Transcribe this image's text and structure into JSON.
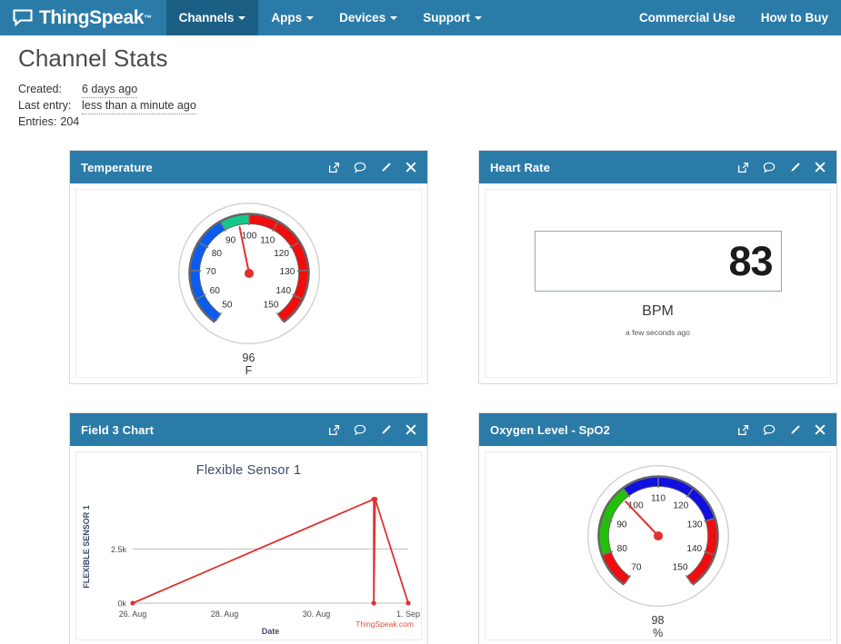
{
  "navbar": {
    "brand": "ThingSpeak",
    "brand_tm": "™",
    "brand_icon": "chat-bubble-icon",
    "items": [
      {
        "label": "Channels",
        "has_caret": true,
        "active": true
      },
      {
        "label": "Apps",
        "has_caret": true,
        "active": false
      },
      {
        "label": "Devices",
        "has_caret": true,
        "active": false
      },
      {
        "label": "Support",
        "has_caret": true,
        "active": false
      }
    ],
    "right_items": [
      {
        "label": "Commercial Use"
      },
      {
        "label": "How to Buy"
      }
    ],
    "bg_color": "#2b7ba8",
    "active_bg_color": "#1c5f84"
  },
  "page": {
    "title": "Channel Stats",
    "stats": {
      "created_label": "Created:",
      "created_value": "6 days ago",
      "last_entry_label": "Last entry:",
      "last_entry_value": "less than a minute ago",
      "entries_label": "Entries:",
      "entries_value": "204"
    }
  },
  "widget_icons": [
    {
      "name": "external-link-icon",
      "title": "Open in new window"
    },
    {
      "name": "comment-icon",
      "title": "Comment"
    },
    {
      "name": "pencil-edit-icon",
      "title": "Edit"
    },
    {
      "name": "close-x-icon",
      "title": "Close"
    }
  ],
  "widgets": [
    {
      "id": "temperature",
      "title": "Temperature",
      "type": "gauge",
      "value": "96",
      "unit": "F"
    },
    {
      "id": "heart-rate",
      "title": "Heart Rate",
      "type": "numeric",
      "value": "83",
      "unit": "BPM",
      "timestamp": "a few seconds ago"
    },
    {
      "id": "field-3-chart",
      "title": "Field 3 Chart",
      "type": "chart",
      "watermark": "ThingSpeak.com"
    },
    {
      "id": "oxygen-level-spo2",
      "title": "Oxygen Level - SpO2",
      "type": "gauge",
      "value": "98",
      "unit": "%"
    }
  ],
  "chart_data": {
    "type": "line",
    "title": "Flexible Sensor 1",
    "xlabel": "Date",
    "ylabel": "FLEXIBLE SENSOR 1",
    "x_ticks": [
      "26. Aug",
      "28. Aug",
      "30. Aug",
      "1. Sep"
    ],
    "y_ticks": [
      "0k",
      "2.5k"
    ],
    "y_tick_values": [
      0,
      2500
    ],
    "ylim": [
      0,
      5200
    ],
    "xlim": [
      "26. Aug",
      "1. Sep"
    ],
    "grid": true,
    "legend": false,
    "line_color": "#e03131",
    "series": [
      {
        "name": "Flexible Sensor 1",
        "points": [
          {
            "x": "26. Aug",
            "x_frac": 0.0,
            "y": 0
          },
          {
            "x": "~31. Aug",
            "x_frac": 0.875,
            "y": 4800
          },
          {
            "x": "~31. Aug",
            "x_frac": 0.875,
            "y": 0
          },
          {
            "x": "~31. Aug",
            "x_frac": 0.88,
            "y": 4800
          },
          {
            "x": "1. Sep",
            "x_frac": 1.0,
            "y": 0
          }
        ]
      }
    ]
  },
  "gauges": {
    "temperature": {
      "min": 50,
      "max": 150,
      "value": 96,
      "tick_labels": [
        50,
        60,
        70,
        80,
        90,
        100,
        110,
        120,
        130,
        140,
        150
      ],
      "start_angle_deg": 215,
      "sweep_deg": 290,
      "bands": [
        {
          "from": 50,
          "to": 90,
          "color": "#0a5bef"
        },
        {
          "from": 90,
          "to": 100,
          "color": "#13c98a"
        },
        {
          "from": 100,
          "to": 150,
          "color": "#f10d0d"
        }
      ],
      "needle_color": "#e03131"
    },
    "oxygen": {
      "min": 70,
      "max": 150,
      "value": 98,
      "tick_labels": [
        70,
        80,
        90,
        100,
        110,
        120,
        130,
        140,
        150
      ],
      "start_angle_deg": 215,
      "sweep_deg": 290,
      "bands": [
        {
          "from": 70,
          "to": 80,
          "color": "#f10d0d"
        },
        {
          "from": 80,
          "to": 100,
          "color": "#22c006"
        },
        {
          "from": 100,
          "to": 130,
          "color": "#1010e0"
        },
        {
          "from": 130,
          "to": 150,
          "color": "#f10d0d"
        }
      ],
      "needle_color": "#e03131"
    }
  }
}
